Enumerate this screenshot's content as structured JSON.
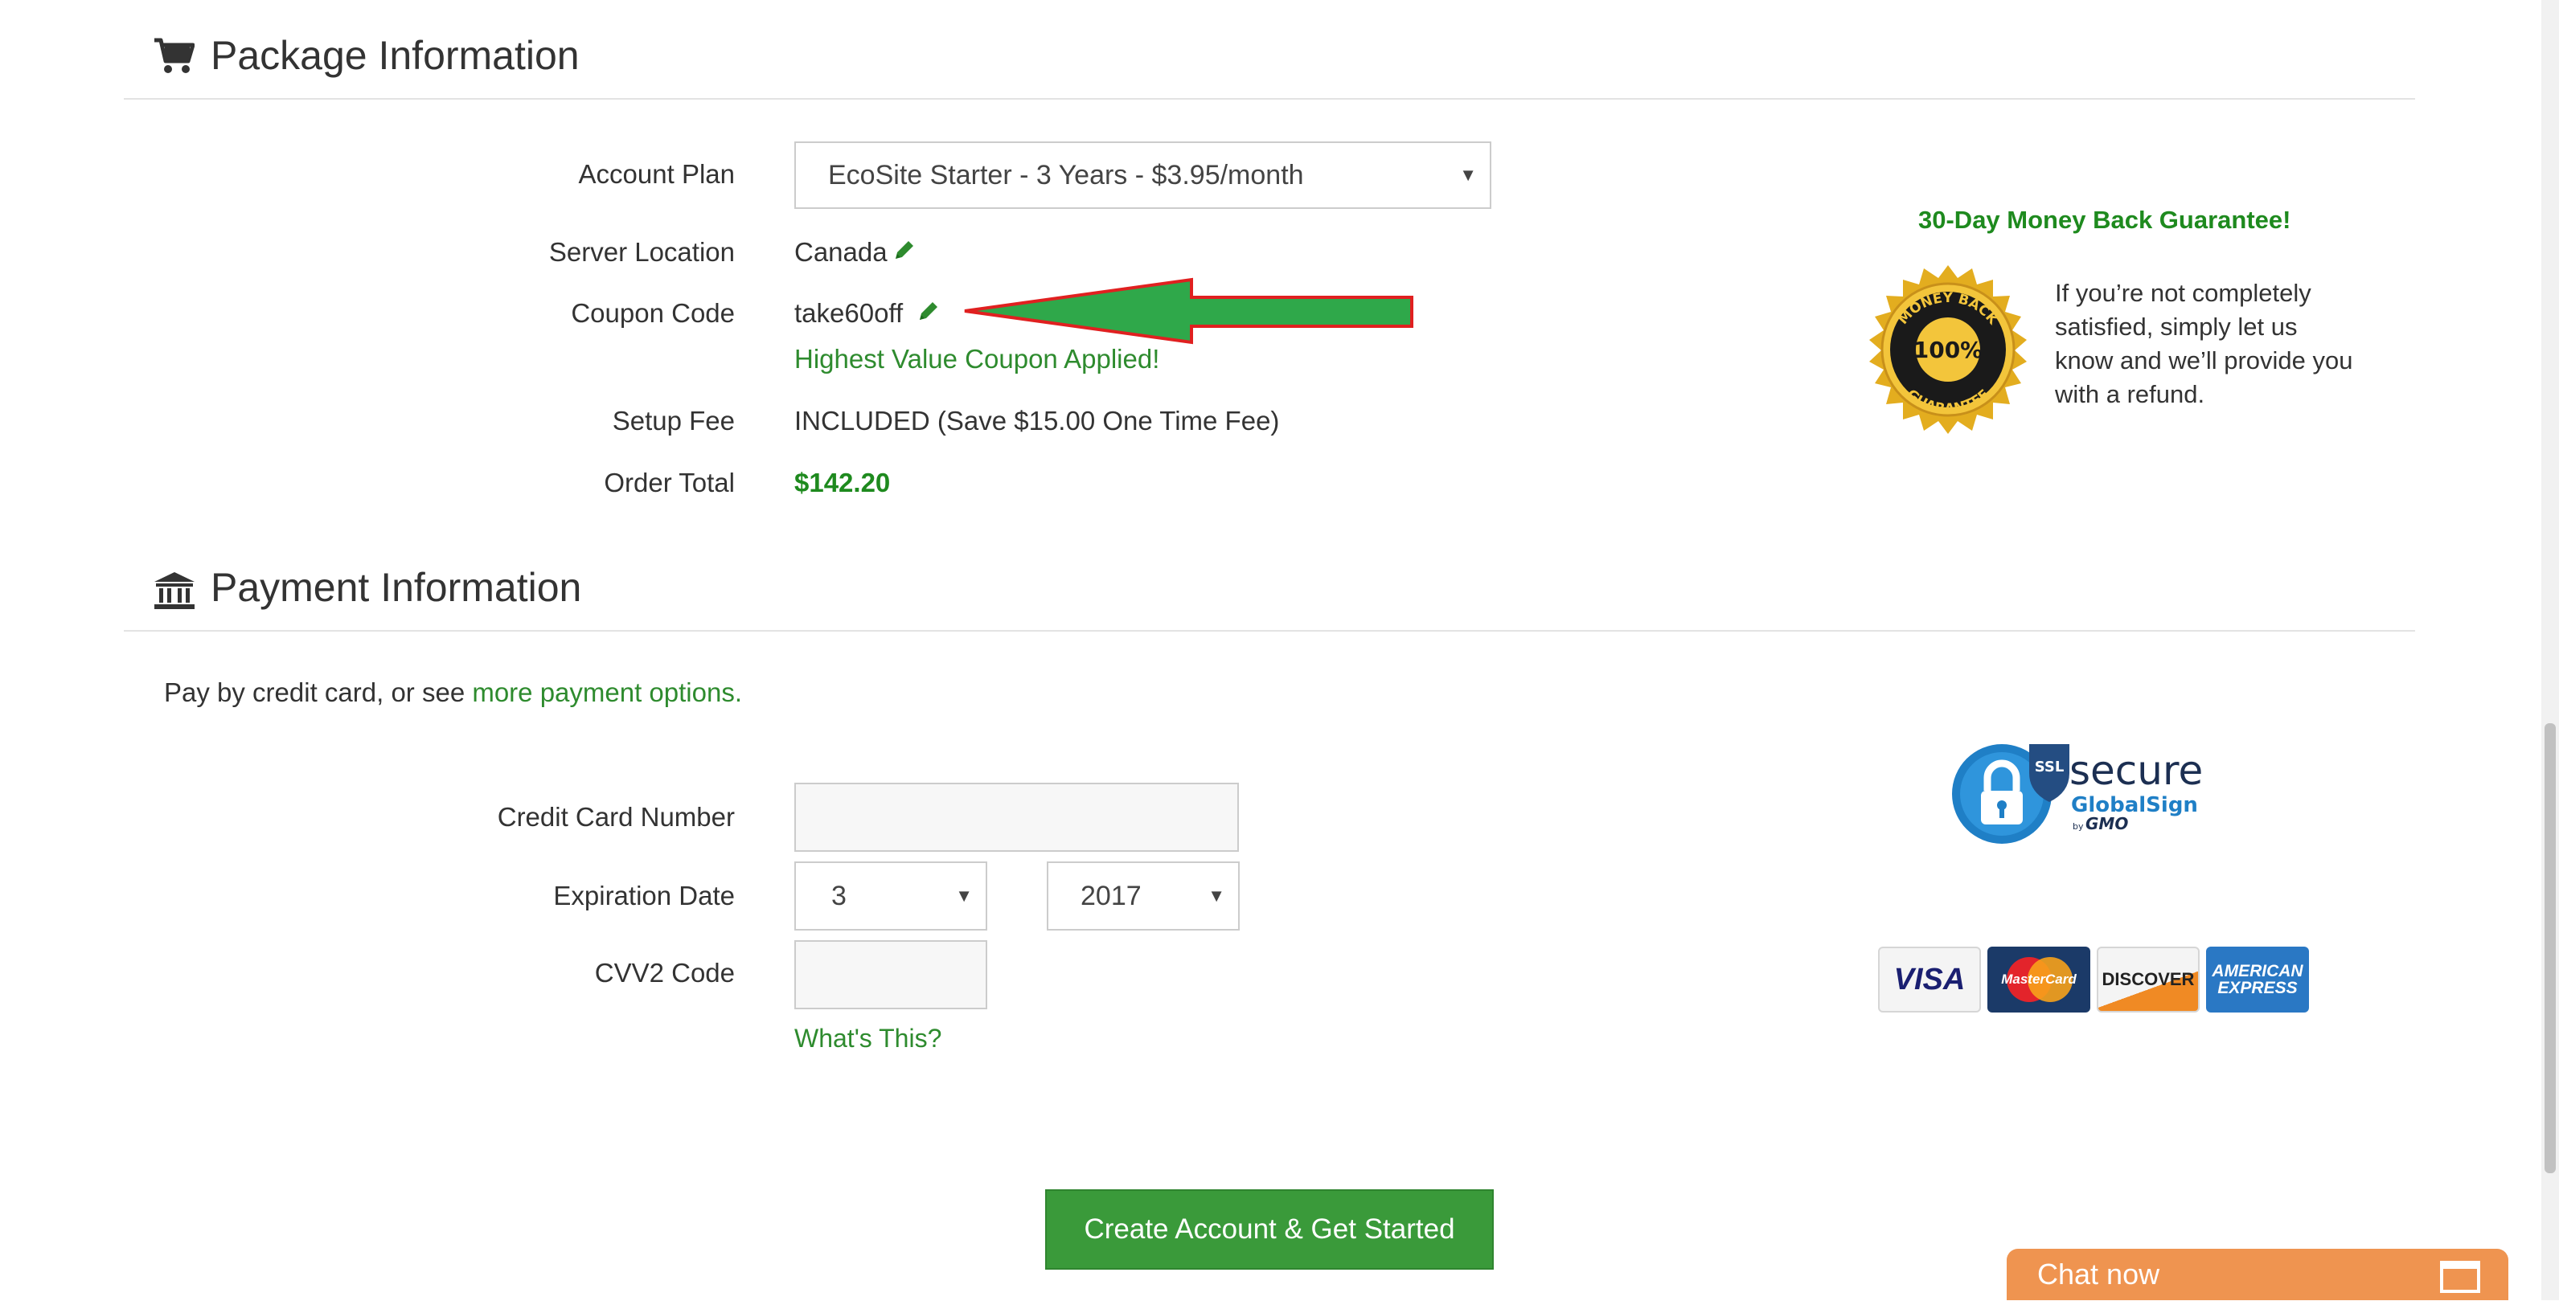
{
  "package": {
    "title": "Package Information",
    "account_plan_label": "Account Plan",
    "account_plan_value": "EcoSite Starter - 3 Years - $3.95/month",
    "server_location_label": "Server Location",
    "server_location_value": "Canada",
    "coupon_label": "Coupon Code",
    "coupon_value": "take60off",
    "coupon_status": "Highest Value Coupon Applied!",
    "setup_fee_label": "Setup Fee",
    "setup_fee_value": "INCLUDED (Save $15.00 One Time Fee)",
    "order_total_label": "Order Total",
    "order_total_value": "$142.20"
  },
  "guarantee": {
    "title": "30-Day Money Back Guarantee!",
    "text": "If you’re not completely satisfied, simply let us know and we’ll provide you with a refund.",
    "seal_top": "MONEY BACK",
    "seal_center": "100%",
    "seal_bottom": "GUARANTEE"
  },
  "payment": {
    "title": "Payment Information",
    "intro_text": "Pay by credit card, or see ",
    "intro_link": "more payment options.",
    "cc_number_label": "Credit Card Number",
    "cc_number_value": "",
    "expiration_label": "Expiration Date",
    "exp_month": "3",
    "exp_year": "2017",
    "cvv_label": "CVV2 Code",
    "cvv_value": "",
    "whats_this": "What's This?",
    "submit_label": "Create Account & Get Started"
  },
  "ssl_badge": {
    "ssl": "SSL",
    "secure": "secure",
    "globalsign": "GlobalSign",
    "by": "by",
    "gmo": "GMO"
  },
  "cards": {
    "visa": "VISA",
    "mastercard": "MasterCard",
    "discover": "DISCOVER",
    "amex_line1": "AMERICAN",
    "amex_line2": "EXPRESS"
  },
  "chat": {
    "label": "Chat now"
  },
  "colors": {
    "accent_green": "#3a9a3a",
    "link_green": "#2e8b2e",
    "chat_orange": "#ef9450",
    "arrow_green": "#2fa84a",
    "arrow_outline": "#e02020"
  },
  "icons": {
    "package": "cart-icon",
    "payment": "bank-icon",
    "edit": "pencil-icon"
  }
}
